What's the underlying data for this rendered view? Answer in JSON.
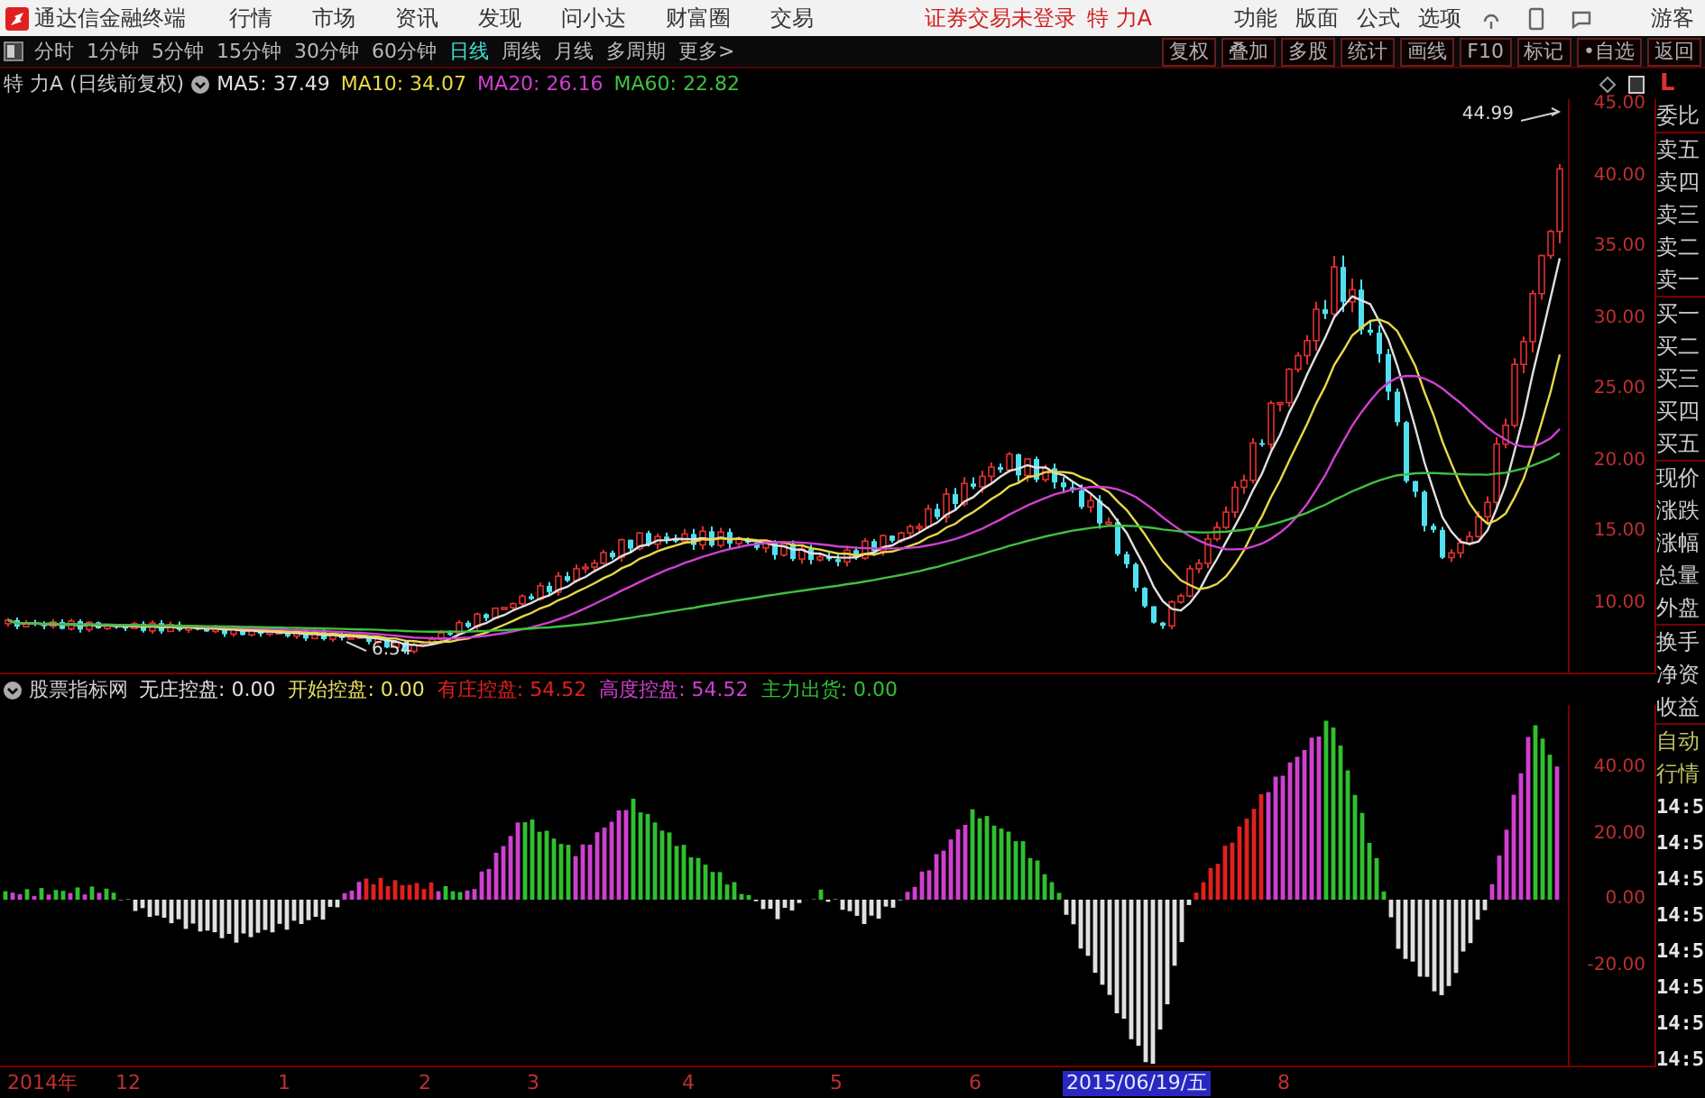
{
  "menubar": {
    "app_title": "通达信金融终端",
    "menus": [
      "行情",
      "市场",
      "资讯",
      "发现",
      "问小达",
      "财富圈",
      "交易"
    ],
    "status": "证券交易未登录",
    "stock": "特 力A",
    "right_menus": [
      "功能",
      "版面",
      "公式",
      "选项"
    ],
    "user": "游客"
  },
  "toolbar": {
    "periods": [
      {
        "label": "分时",
        "selected": false
      },
      {
        "label": "1分钟",
        "selected": false
      },
      {
        "label": "5分钟",
        "selected": false
      },
      {
        "label": "15分钟",
        "selected": false
      },
      {
        "label": "30分钟",
        "selected": false
      },
      {
        "label": "60分钟",
        "selected": false
      },
      {
        "label": "日线",
        "selected": true
      },
      {
        "label": "周线",
        "selected": false
      },
      {
        "label": "月线",
        "selected": false
      },
      {
        "label": "多周期",
        "selected": false
      },
      {
        "label": "更多>",
        "selected": false
      }
    ],
    "actions": [
      "复权",
      "叠加",
      "多股",
      "统计",
      "画线",
      "F10",
      "标记",
      "•自选",
      "返回"
    ]
  },
  "price_panel": {
    "title": "特 力A (日线前复权)",
    "ma": [
      {
        "label": "MA5: 37.49",
        "color": "#e0e0e0"
      },
      {
        "label": "MA10: 34.07",
        "color": "#e8d84a"
      },
      {
        "label": "MA20: 26.16",
        "color": "#d040d0"
      },
      {
        "label": "MA60: 22.82",
        "color": "#40c040"
      }
    ],
    "yticks": [
      "45.00",
      "40.00",
      "35.00",
      "30.00",
      "25.00",
      "20.00",
      "15.00",
      "10.00"
    ],
    "high_label": "44.99",
    "low_label": "6.54"
  },
  "indicator_panel": {
    "title": "股票指标网",
    "lines": [
      {
        "label": "无庄控盘: 0.00",
        "color": "#e0e0e0"
      },
      {
        "label": "开始控盘: 0.00",
        "color": "#e8e060"
      },
      {
        "label": "有庄控盘: 54.52",
        "color": "#e02020"
      },
      {
        "label": "高度控盘: 54.52",
        "color": "#d040d0"
      },
      {
        "label": "主力出货: 0.00",
        "color": "#30c030"
      }
    ],
    "yticks": [
      "40.00",
      "20.00",
      "0.00",
      "-20.00"
    ]
  },
  "date_axis": [
    {
      "label": "2014年",
      "selected": false
    },
    {
      "label": "12",
      "selected": false
    },
    {
      "label": "1",
      "selected": false
    },
    {
      "label": "2",
      "selected": false
    },
    {
      "label": "3",
      "selected": false
    },
    {
      "label": "4",
      "selected": false
    },
    {
      "label": "5",
      "selected": false
    },
    {
      "label": "6",
      "selected": false
    },
    {
      "label": "2015/06/19/五",
      "selected": true
    },
    {
      "label": "8",
      "selected": false
    }
  ],
  "side_panel": {
    "header": "L",
    "labels": [
      "委比",
      "卖五",
      "卖四",
      "卖三",
      "卖二",
      "卖一",
      "买一",
      "买二",
      "买三",
      "买四",
      "买五",
      "现价",
      "涨跌",
      "涨幅",
      "总量",
      "外盘",
      "换手",
      "净资",
      "收益"
    ],
    "mode_labels": [
      "自动",
      "行情"
    ],
    "times": [
      "14:5",
      "14:5",
      "14:5",
      "14:5",
      "14:5",
      "14:5",
      "14:5",
      "14:5"
    ]
  }
}
